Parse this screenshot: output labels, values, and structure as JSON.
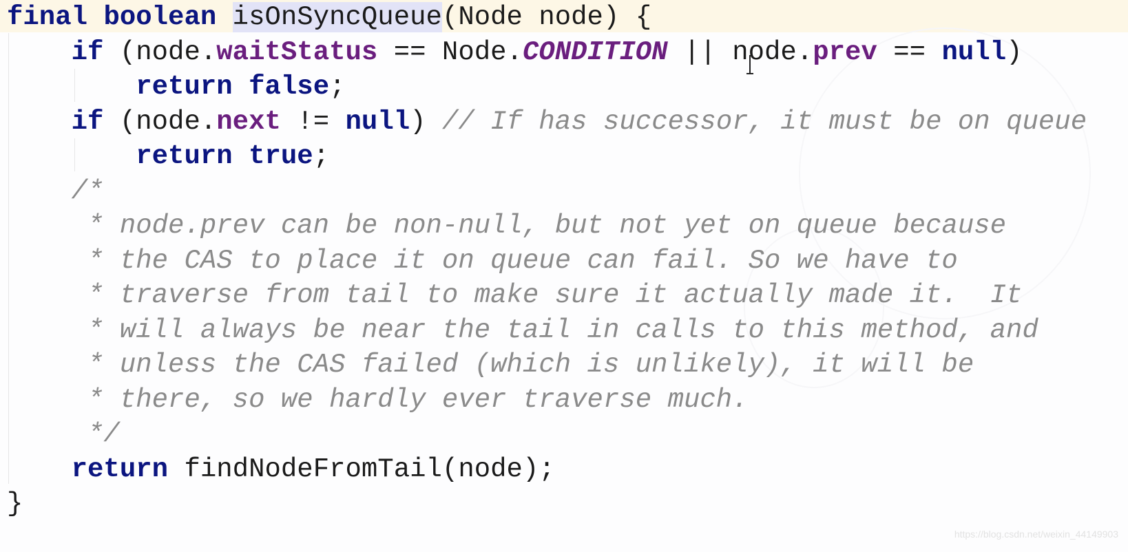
{
  "editor": {
    "language": "java",
    "colors": {
      "keyword": "#0b1580",
      "field": "#6a1e7e",
      "comment": "#8a8a8a",
      "plain": "#1a1a1a",
      "caret_row": "#fdf7e6",
      "identifier_highlight": "#e2e3f7"
    },
    "lines": [
      {
        "tokens": [
          {
            "t": "kw",
            "v": "final"
          },
          {
            "t": "plain",
            "v": " "
          },
          {
            "t": "kw",
            "v": "boolean"
          },
          {
            "t": "plain",
            "v": " "
          },
          {
            "t": "ident-hl",
            "v": "isOnSyncQueue"
          },
          {
            "t": "plain",
            "v": "(Node node) {"
          }
        ]
      },
      {
        "tokens": [
          {
            "t": "plain",
            "v": "    "
          },
          {
            "t": "kw",
            "v": "if"
          },
          {
            "t": "plain",
            "v": " (node."
          },
          {
            "t": "fld",
            "v": "waitStatus"
          },
          {
            "t": "plain",
            "v": " == Node."
          },
          {
            "t": "const",
            "v": "CONDITION"
          },
          {
            "t": "plain",
            "v": " || node."
          },
          {
            "t": "fld",
            "v": "prev"
          },
          {
            "t": "plain",
            "v": " == "
          },
          {
            "t": "kw",
            "v": "null"
          },
          {
            "t": "plain",
            "v": ")"
          }
        ]
      },
      {
        "tokens": [
          {
            "t": "plain",
            "v": "        "
          },
          {
            "t": "kw",
            "v": "return"
          },
          {
            "t": "plain",
            "v": " "
          },
          {
            "t": "kw",
            "v": "false"
          },
          {
            "t": "plain",
            "v": ";"
          }
        ]
      },
      {
        "tokens": [
          {
            "t": "plain",
            "v": "    "
          },
          {
            "t": "kw",
            "v": "if"
          },
          {
            "t": "plain",
            "v": " (node."
          },
          {
            "t": "fld",
            "v": "next"
          },
          {
            "t": "plain",
            "v": " != "
          },
          {
            "t": "kw",
            "v": "null"
          },
          {
            "t": "plain",
            "v": ") "
          },
          {
            "t": "cmt",
            "v": "// If has successor, it must be on queue"
          }
        ]
      },
      {
        "tokens": [
          {
            "t": "plain",
            "v": "        "
          },
          {
            "t": "kw",
            "v": "return"
          },
          {
            "t": "plain",
            "v": " "
          },
          {
            "t": "kw",
            "v": "true"
          },
          {
            "t": "plain",
            "v": ";"
          }
        ]
      },
      {
        "tokens": [
          {
            "t": "plain",
            "v": "    "
          },
          {
            "t": "cmt",
            "v": "/*"
          }
        ]
      },
      {
        "tokens": [
          {
            "t": "plain",
            "v": "     "
          },
          {
            "t": "cmt",
            "v": "* node.prev can be non-null, but not yet on queue because"
          }
        ]
      },
      {
        "tokens": [
          {
            "t": "plain",
            "v": "     "
          },
          {
            "t": "cmt",
            "v": "* the CAS to place it on queue can fail. So we have to"
          }
        ]
      },
      {
        "tokens": [
          {
            "t": "plain",
            "v": "     "
          },
          {
            "t": "cmt",
            "v": "* traverse from tail to make sure it actually made it.  It"
          }
        ]
      },
      {
        "tokens": [
          {
            "t": "plain",
            "v": "     "
          },
          {
            "t": "cmt",
            "v": "* will always be near the tail in calls to this method, and"
          }
        ]
      },
      {
        "tokens": [
          {
            "t": "plain",
            "v": "     "
          },
          {
            "t": "cmt",
            "v": "* unless the CAS failed (which is unlikely), it will be"
          }
        ]
      },
      {
        "tokens": [
          {
            "t": "plain",
            "v": "     "
          },
          {
            "t": "cmt",
            "v": "* there, so we hardly ever traverse much."
          }
        ]
      },
      {
        "tokens": [
          {
            "t": "plain",
            "v": "     "
          },
          {
            "t": "cmt",
            "v": "*/"
          }
        ]
      },
      {
        "tokens": [
          {
            "t": "plain",
            "v": "    "
          },
          {
            "t": "kw",
            "v": "return"
          },
          {
            "t": "plain",
            "v": " findNodeFromTail(node);"
          }
        ]
      },
      {
        "tokens": [
          {
            "t": "plain",
            "v": "}"
          }
        ]
      }
    ]
  },
  "watermark": {
    "text": "https://blog.csdn.net/weixin_44149903"
  },
  "icons": {
    "mouse_cursor": "text-ibeam-cursor"
  }
}
